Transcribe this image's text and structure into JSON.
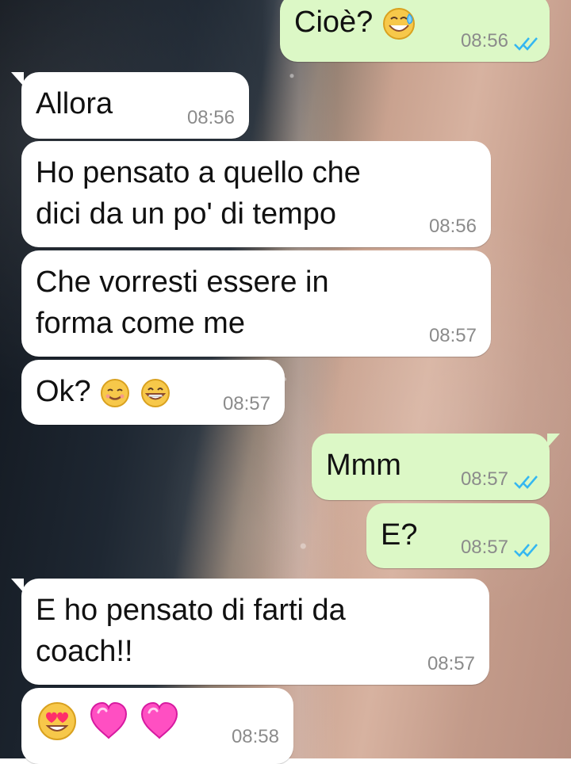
{
  "messages": [
    {
      "id": "m1",
      "direction": "outgoing",
      "text": "Cioè?",
      "emoji": [
        "sweat-smile"
      ],
      "time": "08:56",
      "read": true
    },
    {
      "id": "m2",
      "direction": "incoming",
      "text": "Allora",
      "time": "08:56"
    },
    {
      "id": "m3",
      "direction": "incoming",
      "text": "Ho pensato a quello che dici da un po' di tempo",
      "time": "08:56"
    },
    {
      "id": "m4",
      "direction": "incoming",
      "text": "Che vorresti essere in forma come me",
      "time": "08:57"
    },
    {
      "id": "m5",
      "direction": "incoming",
      "text": "Ok?",
      "emoji": [
        "smiling-face",
        "grinning-face"
      ],
      "time": "08:57"
    },
    {
      "id": "m6",
      "direction": "outgoing",
      "text": "Mmm",
      "time": "08:57",
      "read": true
    },
    {
      "id": "m7",
      "direction": "outgoing",
      "text": "E?",
      "time": "08:57",
      "read": true
    },
    {
      "id": "m8",
      "direction": "incoming",
      "text": "E ho pensato di farti da coach!!",
      "time": "08:57"
    },
    {
      "id": "m9",
      "direction": "incoming",
      "text": "",
      "emoji": [
        "heart-eyes",
        "pink-heart",
        "pink-heart"
      ],
      "time": "08:58"
    }
  ],
  "colors": {
    "incoming_bubble": "#ffffff",
    "outgoing_bubble": "#dcf8c6",
    "timestamp": "#8b8b8b",
    "read_ticks": "#34b7f1"
  },
  "icons": {
    "read_receipt": "double-check-icon"
  }
}
